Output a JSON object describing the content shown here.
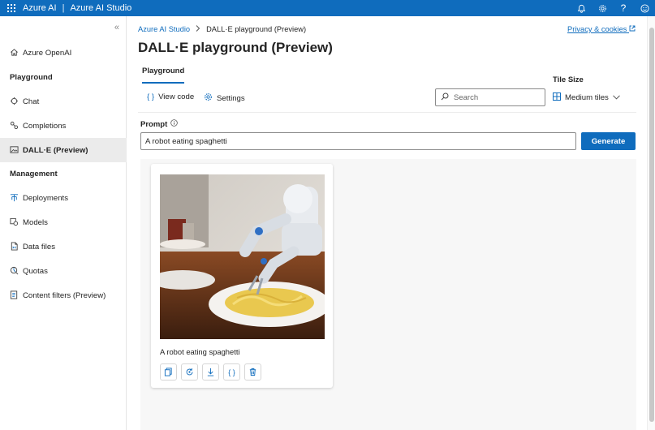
{
  "topbar": {
    "brand": "Azure AI",
    "separator": "|",
    "product": "Azure AI Studio",
    "icons": [
      "bell-icon",
      "gear-icon",
      "help-icon",
      "feedback-icon"
    ],
    "help_glyph": "?"
  },
  "sidebar": {
    "collapse_glyph": "«",
    "items": [
      {
        "label": "Azure OpenAI",
        "icon": "home-icon"
      },
      {
        "label": "Playground",
        "type": "header"
      },
      {
        "label": "Chat",
        "icon": "chat-icon"
      },
      {
        "label": "Completions",
        "icon": "completions-icon"
      },
      {
        "label": "DALL·E (Preview)",
        "icon": "image-icon",
        "active": true
      },
      {
        "label": "Management",
        "type": "header"
      },
      {
        "label": "Deployments",
        "icon": "deployments-icon"
      },
      {
        "label": "Models",
        "icon": "models-icon"
      },
      {
        "label": "Data files",
        "icon": "data-files-icon"
      },
      {
        "label": "Quotas",
        "icon": "quotas-icon"
      },
      {
        "label": "Content filters (Preview)",
        "icon": "content-filters-icon"
      }
    ]
  },
  "breadcrumb": {
    "root": "Azure AI Studio",
    "current": "DALL·E playground (Preview)"
  },
  "privacy_link": "Privacy & cookies",
  "page_title": "DALL·E playground (Preview)",
  "tabs": [
    {
      "label": "Playground",
      "active": true
    }
  ],
  "toolbar": {
    "view_code": "View code",
    "settings": "Settings",
    "search_placeholder": "Search"
  },
  "tile_size": {
    "label": "Tile Size",
    "value": "Medium tiles"
  },
  "prompt": {
    "label": "Prompt",
    "value": "A robot eating spaghetti",
    "generate_label": "Generate"
  },
  "gallery": [
    {
      "caption": "A robot eating spaghetti",
      "actions": [
        "copy-icon",
        "regenerate-icon",
        "download-icon",
        "code-icon",
        "delete-icon"
      ]
    }
  ],
  "colors": {
    "accent": "#0f6cbd",
    "active_nav_bg": "#ebebeb",
    "gallery_bg": "#f7f7f7"
  }
}
